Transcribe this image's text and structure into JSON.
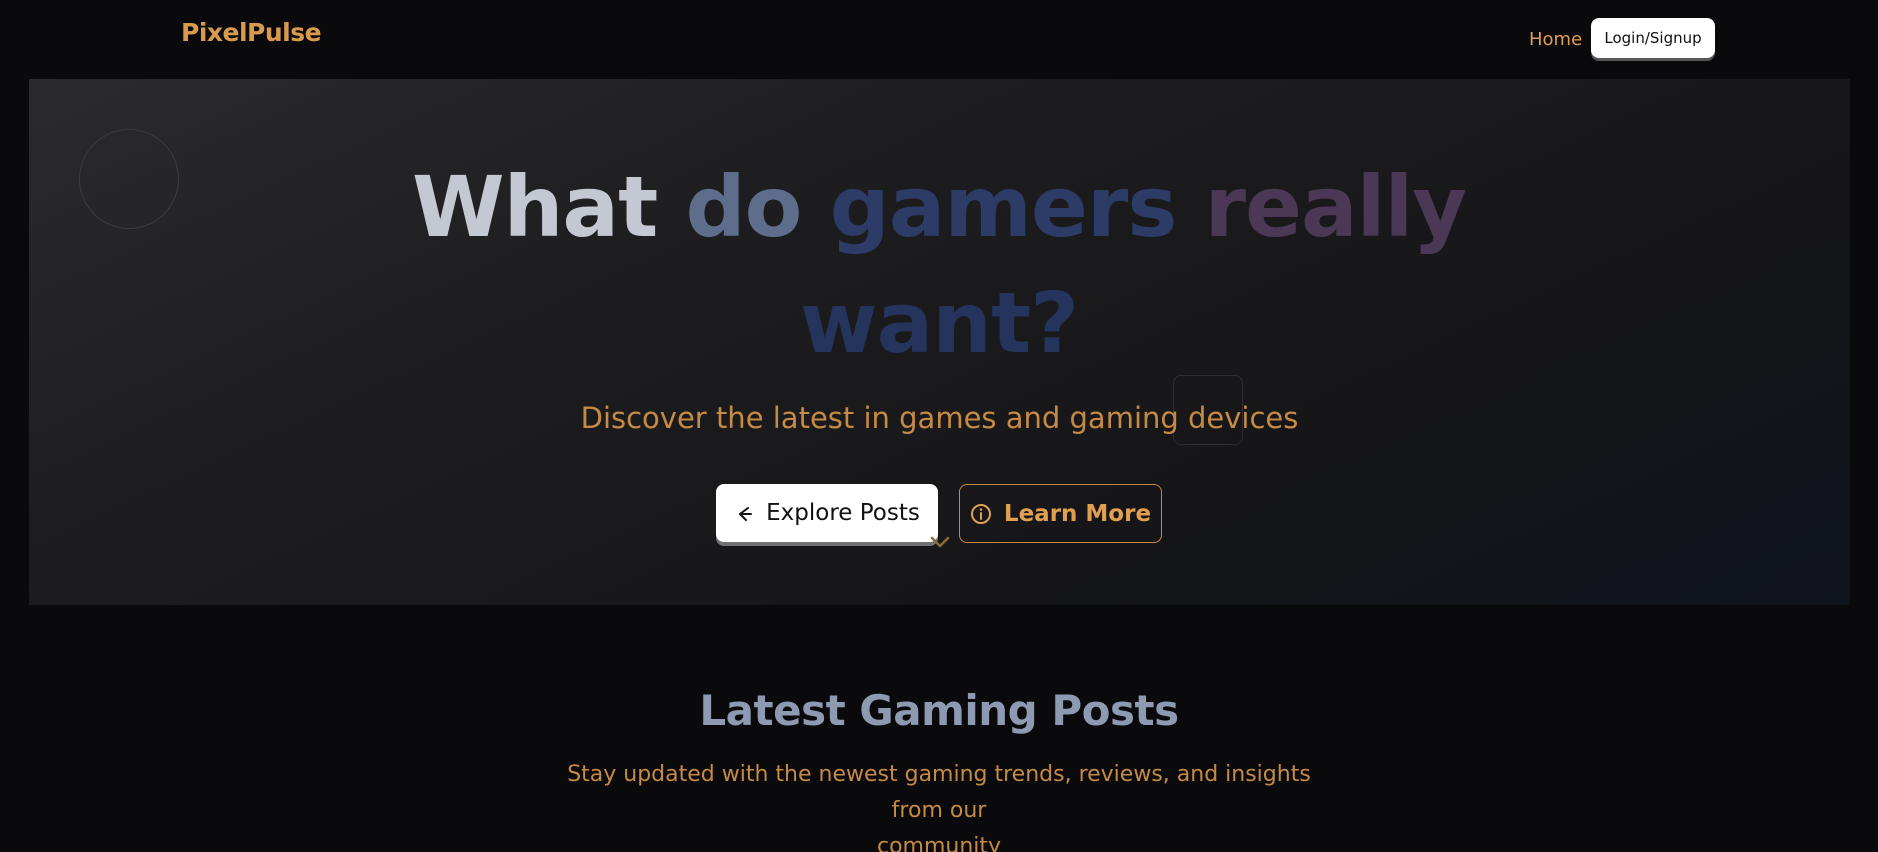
{
  "nav": {
    "brand": "PixelPulse",
    "home_label": "Home",
    "login_label": "Login/Signup"
  },
  "hero": {
    "title_words": [
      "What",
      "do",
      "gamers",
      "really",
      "want?"
    ],
    "subtitle": "Discover the latest in games and gaming devices",
    "explore_label": "Explore Posts",
    "explore_icon": "arrow-icon",
    "learn_label": "Learn More",
    "learn_icon": "info-icon",
    "scroll_icon": "chevron-down-icon"
  },
  "posts_section": {
    "title": "Latest Gaming Posts",
    "subtitle_line1": "Stay updated with the newest gaming trends, reviews, and insights from our",
    "subtitle_line2": "community"
  },
  "colors": {
    "brand": "#d89a4c",
    "accent": "#c58a44",
    "background": "#0a0a0c"
  }
}
